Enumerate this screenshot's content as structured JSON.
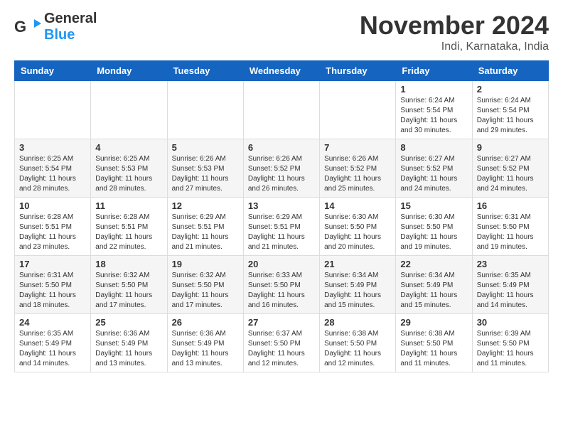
{
  "header": {
    "logo_general": "General",
    "logo_blue": "Blue",
    "month_title": "November 2024",
    "location": "Indi, Karnataka, India"
  },
  "weekdays": [
    "Sunday",
    "Monday",
    "Tuesday",
    "Wednesday",
    "Thursday",
    "Friday",
    "Saturday"
  ],
  "weeks": [
    [
      {
        "day": "",
        "sunrise": "",
        "sunset": "",
        "daylight": ""
      },
      {
        "day": "",
        "sunrise": "",
        "sunset": "",
        "daylight": ""
      },
      {
        "day": "",
        "sunrise": "",
        "sunset": "",
        "daylight": ""
      },
      {
        "day": "",
        "sunrise": "",
        "sunset": "",
        "daylight": ""
      },
      {
        "day": "",
        "sunrise": "",
        "sunset": "",
        "daylight": ""
      },
      {
        "day": "1",
        "sunrise": "Sunrise: 6:24 AM",
        "sunset": "Sunset: 5:54 PM",
        "daylight": "Daylight: 11 hours and 30 minutes."
      },
      {
        "day": "2",
        "sunrise": "Sunrise: 6:24 AM",
        "sunset": "Sunset: 5:54 PM",
        "daylight": "Daylight: 11 hours and 29 minutes."
      }
    ],
    [
      {
        "day": "3",
        "sunrise": "Sunrise: 6:25 AM",
        "sunset": "Sunset: 5:54 PM",
        "daylight": "Daylight: 11 hours and 28 minutes."
      },
      {
        "day": "4",
        "sunrise": "Sunrise: 6:25 AM",
        "sunset": "Sunset: 5:53 PM",
        "daylight": "Daylight: 11 hours and 28 minutes."
      },
      {
        "day": "5",
        "sunrise": "Sunrise: 6:26 AM",
        "sunset": "Sunset: 5:53 PM",
        "daylight": "Daylight: 11 hours and 27 minutes."
      },
      {
        "day": "6",
        "sunrise": "Sunrise: 6:26 AM",
        "sunset": "Sunset: 5:52 PM",
        "daylight": "Daylight: 11 hours and 26 minutes."
      },
      {
        "day": "7",
        "sunrise": "Sunrise: 6:26 AM",
        "sunset": "Sunset: 5:52 PM",
        "daylight": "Daylight: 11 hours and 25 minutes."
      },
      {
        "day": "8",
        "sunrise": "Sunrise: 6:27 AM",
        "sunset": "Sunset: 5:52 PM",
        "daylight": "Daylight: 11 hours and 24 minutes."
      },
      {
        "day": "9",
        "sunrise": "Sunrise: 6:27 AM",
        "sunset": "Sunset: 5:52 PM",
        "daylight": "Daylight: 11 hours and 24 minutes."
      }
    ],
    [
      {
        "day": "10",
        "sunrise": "Sunrise: 6:28 AM",
        "sunset": "Sunset: 5:51 PM",
        "daylight": "Daylight: 11 hours and 23 minutes."
      },
      {
        "day": "11",
        "sunrise": "Sunrise: 6:28 AM",
        "sunset": "Sunset: 5:51 PM",
        "daylight": "Daylight: 11 hours and 22 minutes."
      },
      {
        "day": "12",
        "sunrise": "Sunrise: 6:29 AM",
        "sunset": "Sunset: 5:51 PM",
        "daylight": "Daylight: 11 hours and 21 minutes."
      },
      {
        "day": "13",
        "sunrise": "Sunrise: 6:29 AM",
        "sunset": "Sunset: 5:51 PM",
        "daylight": "Daylight: 11 hours and 21 minutes."
      },
      {
        "day": "14",
        "sunrise": "Sunrise: 6:30 AM",
        "sunset": "Sunset: 5:50 PM",
        "daylight": "Daylight: 11 hours and 20 minutes."
      },
      {
        "day": "15",
        "sunrise": "Sunrise: 6:30 AM",
        "sunset": "Sunset: 5:50 PM",
        "daylight": "Daylight: 11 hours and 19 minutes."
      },
      {
        "day": "16",
        "sunrise": "Sunrise: 6:31 AM",
        "sunset": "Sunset: 5:50 PM",
        "daylight": "Daylight: 11 hours and 19 minutes."
      }
    ],
    [
      {
        "day": "17",
        "sunrise": "Sunrise: 6:31 AM",
        "sunset": "Sunset: 5:50 PM",
        "daylight": "Daylight: 11 hours and 18 minutes."
      },
      {
        "day": "18",
        "sunrise": "Sunrise: 6:32 AM",
        "sunset": "Sunset: 5:50 PM",
        "daylight": "Daylight: 11 hours and 17 minutes."
      },
      {
        "day": "19",
        "sunrise": "Sunrise: 6:32 AM",
        "sunset": "Sunset: 5:50 PM",
        "daylight": "Daylight: 11 hours and 17 minutes."
      },
      {
        "day": "20",
        "sunrise": "Sunrise: 6:33 AM",
        "sunset": "Sunset: 5:50 PM",
        "daylight": "Daylight: 11 hours and 16 minutes."
      },
      {
        "day": "21",
        "sunrise": "Sunrise: 6:34 AM",
        "sunset": "Sunset: 5:49 PM",
        "daylight": "Daylight: 11 hours and 15 minutes."
      },
      {
        "day": "22",
        "sunrise": "Sunrise: 6:34 AM",
        "sunset": "Sunset: 5:49 PM",
        "daylight": "Daylight: 11 hours and 15 minutes."
      },
      {
        "day": "23",
        "sunrise": "Sunrise: 6:35 AM",
        "sunset": "Sunset: 5:49 PM",
        "daylight": "Daylight: 11 hours and 14 minutes."
      }
    ],
    [
      {
        "day": "24",
        "sunrise": "Sunrise: 6:35 AM",
        "sunset": "Sunset: 5:49 PM",
        "daylight": "Daylight: 11 hours and 14 minutes."
      },
      {
        "day": "25",
        "sunrise": "Sunrise: 6:36 AM",
        "sunset": "Sunset: 5:49 PM",
        "daylight": "Daylight: 11 hours and 13 minutes."
      },
      {
        "day": "26",
        "sunrise": "Sunrise: 6:36 AM",
        "sunset": "Sunset: 5:49 PM",
        "daylight": "Daylight: 11 hours and 13 minutes."
      },
      {
        "day": "27",
        "sunrise": "Sunrise: 6:37 AM",
        "sunset": "Sunset: 5:50 PM",
        "daylight": "Daylight: 11 hours and 12 minutes."
      },
      {
        "day": "28",
        "sunrise": "Sunrise: 6:38 AM",
        "sunset": "Sunset: 5:50 PM",
        "daylight": "Daylight: 11 hours and 12 minutes."
      },
      {
        "day": "29",
        "sunrise": "Sunrise: 6:38 AM",
        "sunset": "Sunset: 5:50 PM",
        "daylight": "Daylight: 11 hours and 11 minutes."
      },
      {
        "day": "30",
        "sunrise": "Sunrise: 6:39 AM",
        "sunset": "Sunset: 5:50 PM",
        "daylight": "Daylight: 11 hours and 11 minutes."
      }
    ]
  ]
}
